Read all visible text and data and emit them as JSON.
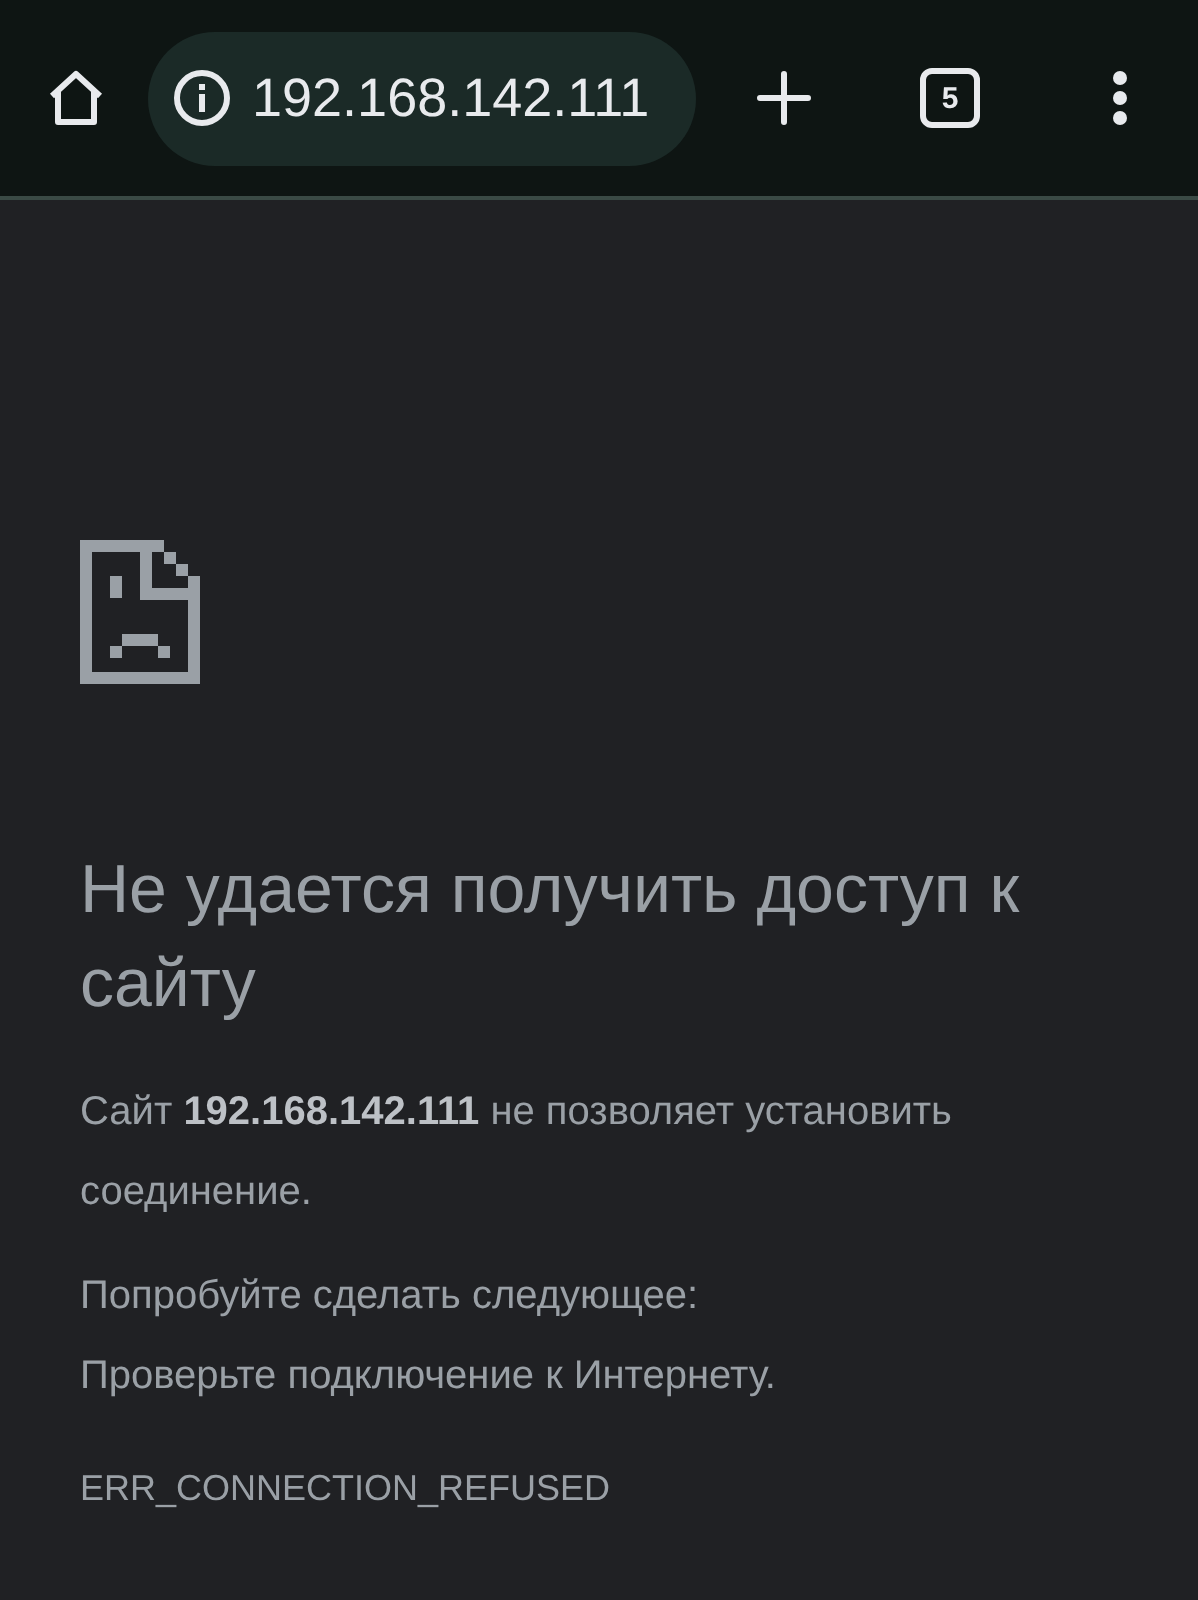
{
  "toolbar": {
    "url": "192.168.142.111",
    "tab_count": "5"
  },
  "error": {
    "title": "Не удается получить доступ к сайту",
    "message": "Сайт **192.168.142.111** не позволяет установить соединение.",
    "suggestions_heading": "Попробуйте сделать следующее:",
    "suggestions": [
      "Проверьте подключение к Интернету."
    ],
    "code": "ERR_CONNECTION_REFUSED"
  }
}
